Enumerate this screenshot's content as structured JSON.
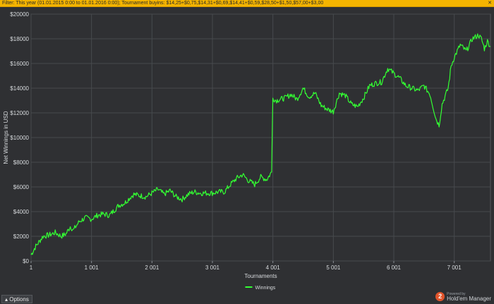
{
  "filter": {
    "text": "Filter: This year (01.01.2015 0:00 to 01.01.2016 0:00); Tournament buyins: $14,25+$0,75,$14,31+$0,69,$14,41+$0,59,$28,50+$1,50,$57,00+$3,00",
    "close_icon": "x-icon"
  },
  "options_label": "Options",
  "options_icon": "triangle-up-icon",
  "brand": {
    "powered": "Powered by",
    "name": "Hold'em Manager",
    "badge": "2"
  },
  "colors": {
    "line": "#33ff33",
    "grid": "#474a4e",
    "axis_text": "#d7dadd",
    "background": "#2f3033"
  },
  "chart_data": {
    "type": "line",
    "title": "",
    "xlabel": "Tournaments",
    "ylabel": "Net Winnings in USD",
    "xlim": [
      1,
      7600
    ],
    "ylim": [
      0,
      20000
    ],
    "x_ticks": [
      1,
      1001,
      2001,
      3001,
      4001,
      5001,
      6001,
      7001
    ],
    "x_tick_labels": [
      "1",
      "1 001",
      "2 001",
      "3 001",
      "4 001",
      "5 001",
      "6 001",
      "7 001"
    ],
    "y_ticks": [
      0,
      2000,
      4000,
      6000,
      8000,
      10000,
      12000,
      14000,
      16000,
      18000,
      20000
    ],
    "y_tick_labels": [
      "$0",
      "$2000",
      "$4000",
      "$6000",
      "$8000",
      "$10000",
      "$12000",
      "$14000",
      "$16000",
      "$18000",
      "$20000"
    ],
    "grid": true,
    "legend_position": "bottom-center",
    "series": [
      {
        "name": "Winnings",
        "color": "#33ff33",
        "x": [
          1,
          80,
          200,
          300,
          400,
          500,
          580,
          650,
          700,
          800,
          900,
          1000,
          1100,
          1200,
          1300,
          1450,
          1550,
          1650,
          1700,
          1800,
          1900,
          2000,
          2100,
          2200,
          2300,
          2400,
          2500,
          2600,
          2700,
          2800,
          2900,
          3000,
          3100,
          3200,
          3300,
          3400,
          3500,
          3600,
          3700,
          3800,
          3900,
          3980,
          4000,
          4050,
          4200,
          4300,
          4400,
          4500,
          4600,
          4700,
          4800,
          4900,
          5000,
          5100,
          5200,
          5300,
          5400,
          5500,
          5600,
          5700,
          5800,
          5900,
          6000,
          6100,
          6200,
          6300,
          6400,
          6500,
          6600,
          6700,
          6750,
          6800,
          6900,
          6950,
          7000,
          7100,
          7200,
          7300,
          7400,
          7450,
          7500,
          7550,
          7600
        ],
        "values": [
          500,
          1200,
          2000,
          2100,
          2300,
          2000,
          2200,
          2800,
          2500,
          3200,
          3500,
          3400,
          3700,
          3800,
          3700,
          4500,
          4700,
          5200,
          5400,
          5300,
          5200,
          5500,
          5800,
          5400,
          5700,
          5200,
          5000,
          5400,
          5600,
          5500,
          5500,
          5500,
          5600,
          5600,
          6200,
          6700,
          7000,
          6500,
          6200,
          6800,
          6600,
          7200,
          13200,
          13000,
          13200,
          13500,
          13100,
          14000,
          13300,
          13600,
          12600,
          12300,
          12100,
          13600,
          13400,
          12700,
          12500,
          13200,
          14200,
          14400,
          14500,
          15600,
          15200,
          14800,
          14200,
          14000,
          13800,
          14200,
          13500,
          11500,
          11000,
          12700,
          14000,
          15800,
          16500,
          17500,
          17000,
          18000,
          18300,
          18000,
          17200,
          17800,
          17400
        ]
      }
    ]
  }
}
